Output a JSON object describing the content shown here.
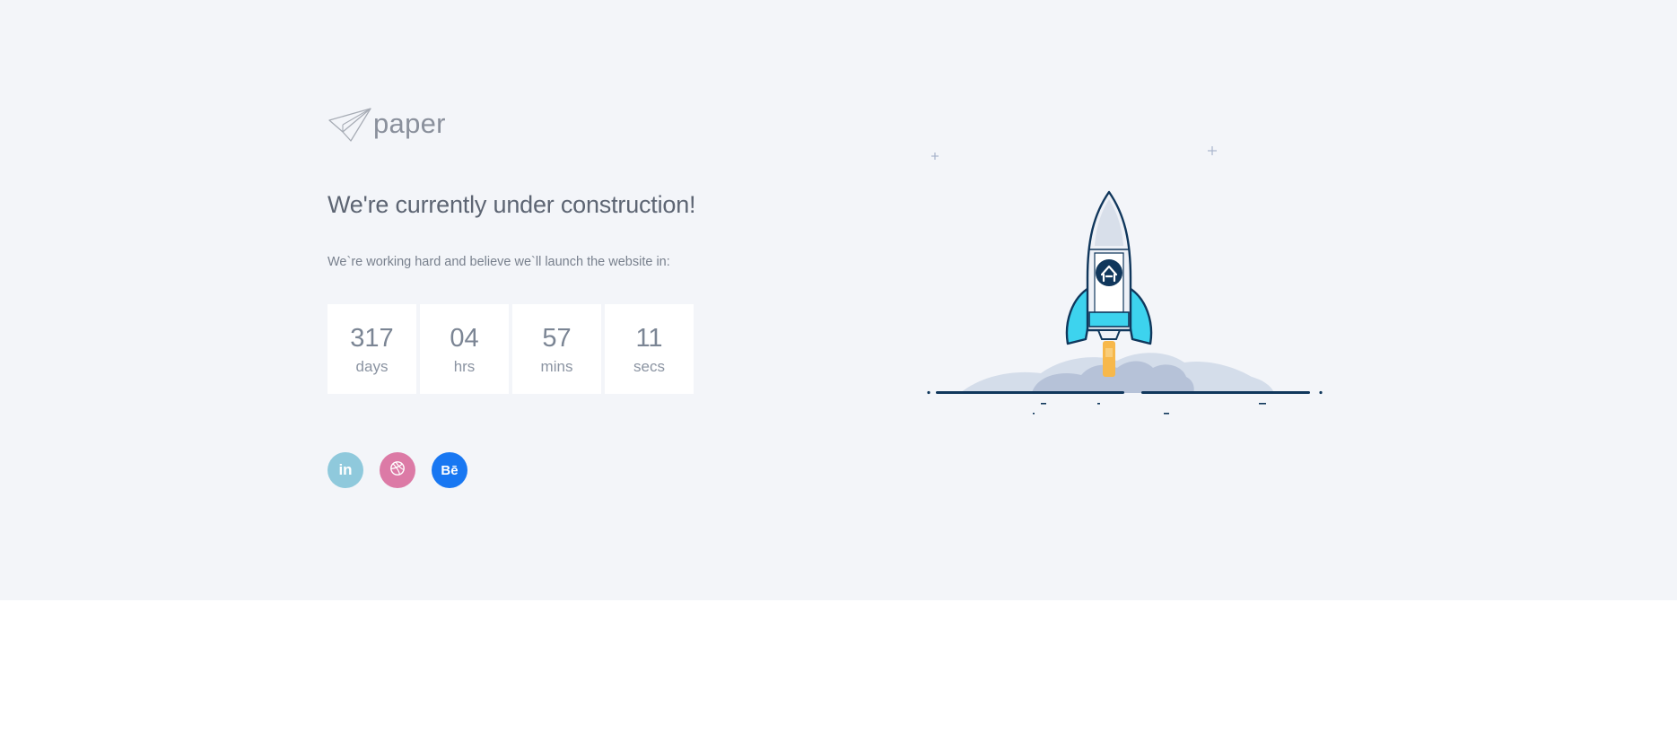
{
  "brand": {
    "logo_text": "paper",
    "logo_icon": "paper-plane-icon"
  },
  "hero": {
    "headline": "We're currently under construction!",
    "subtext": "We`re working hard and believe we`ll launch the website in:"
  },
  "countdown": [
    {
      "value": "317",
      "label": "days"
    },
    {
      "value": "04",
      "label": "hrs"
    },
    {
      "value": "57",
      "label": "mins"
    },
    {
      "value": "11",
      "label": "secs"
    }
  ],
  "socials": [
    {
      "name": "linkedin",
      "glyph": "in",
      "color": "#8fc9dc",
      "icon": "linkedin-icon"
    },
    {
      "name": "dribbble",
      "glyph": "",
      "color": "#dc7aa6",
      "icon": "dribbble-icon"
    },
    {
      "name": "behance",
      "glyph": "Bē",
      "color": "#1877f2",
      "icon": "behance-icon"
    }
  ],
  "colors": {
    "hero_background": "#f3f5f9",
    "rocket_blue": "#3dd3ee",
    "rocket_outline": "#10375c",
    "flame": "#f7b84b",
    "smoke": "#b6c2d8"
  },
  "illustration": {
    "icon": "rocket-illustration"
  }
}
